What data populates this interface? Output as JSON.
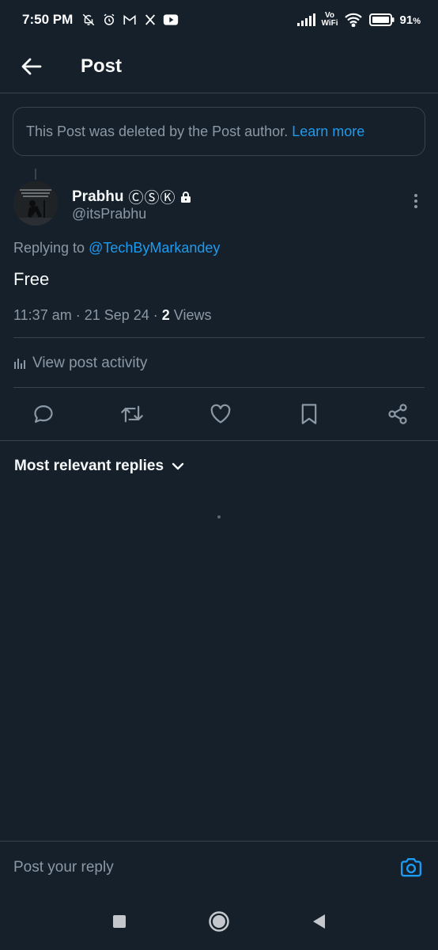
{
  "status_bar": {
    "time": "7:50 PM",
    "vowifi_top": "Vo",
    "vowifi_bottom": "WiFi",
    "battery": "91",
    "battery_unit": "%"
  },
  "header": {
    "title": "Post"
  },
  "notice": {
    "text": "This Post was deleted by the Post author.",
    "link": "Learn more"
  },
  "post": {
    "author_name": "Prabhu",
    "author_badges": "ⒸⓈⓀ",
    "handle": "@itsPrabhu",
    "replying_prefix": "Replying to",
    "replying_to": "@TechByMarkandey",
    "text": "Free",
    "timestamp": "11:37 am · 21 Sep 24 · ",
    "views_count": "2",
    "views_label": " Views"
  },
  "activity": {
    "label": "View post activity"
  },
  "sort": {
    "label": "Most relevant replies"
  },
  "reply": {
    "placeholder": "Post your reply"
  },
  "colors": {
    "background": "#15202b",
    "accent": "#1d9bf0",
    "muted": "#8b98a5",
    "border": "#38444d"
  }
}
